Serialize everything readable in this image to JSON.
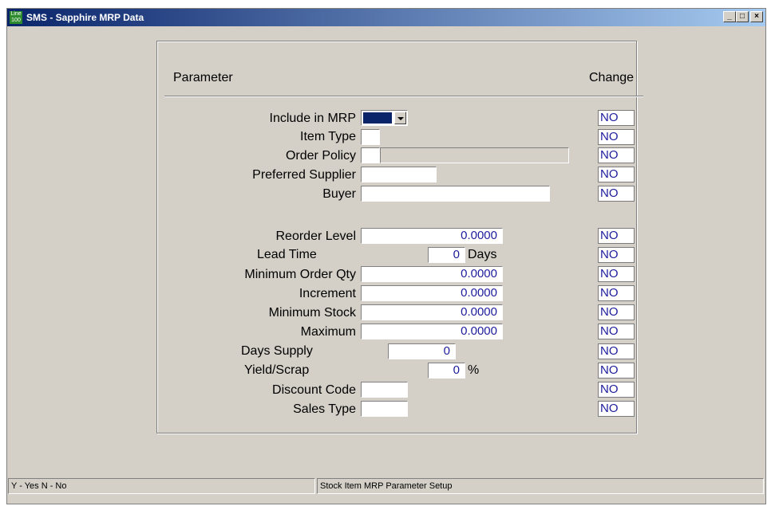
{
  "window": {
    "title": "SMS - Sapphire MRP Data",
    "icon_label": "Line 100",
    "controls": {
      "minimize": "_",
      "maximize": "□",
      "close": "×"
    }
  },
  "header": {
    "parameter": "Parameter",
    "change": "Change"
  },
  "fields": {
    "include_in_mrp": {
      "label": "Include in MRP",
      "change": "NO"
    },
    "item_type": {
      "label": "Item Type",
      "change": "NO"
    },
    "order_policy": {
      "label": "Order Policy",
      "change": "NO"
    },
    "preferred_supplier": {
      "label": "Preferred Supplier",
      "change": "NO"
    },
    "buyer": {
      "label": "Buyer",
      "change": "NO"
    },
    "reorder_level": {
      "label": "Reorder Level",
      "value": "0.0000",
      "change": "NO"
    },
    "lead_time": {
      "label": "Lead Time",
      "value": "0",
      "unit": "Days",
      "change": "NO"
    },
    "minimum_order_qty": {
      "label": "Minimum Order Qty",
      "value": "0.0000",
      "change": "NO"
    },
    "increment": {
      "label": "Increment",
      "value": "0.0000",
      "change": "NO"
    },
    "minimum_stock": {
      "label": "Minimum Stock",
      "value": "0.0000",
      "change": "NO"
    },
    "maximum": {
      "label": "Maximum",
      "value": "0.0000",
      "change": "NO"
    },
    "days_supply": {
      "label": "Days Supply",
      "value": "0",
      "change": "NO"
    },
    "yield_scrap": {
      "label": "Yield/Scrap",
      "value": "0",
      "unit": "%",
      "change": "NO"
    },
    "discount_code": {
      "label": "Discount Code",
      "change": "NO"
    },
    "sales_type": {
      "label": "Sales Type",
      "change": "NO"
    }
  },
  "status": {
    "left": "Y - Yes  N - No",
    "right": "Stock Item MRP Parameter Setup"
  }
}
